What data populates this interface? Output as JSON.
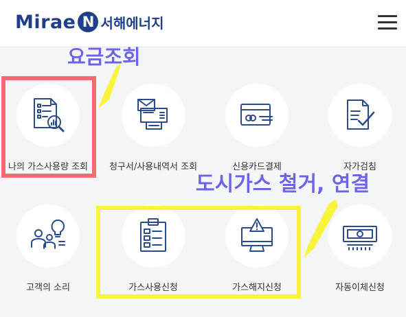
{
  "header": {
    "logo_main": "Mirae",
    "logo_letter": "N",
    "logo_korean": "서해에너지"
  },
  "services": [
    {
      "label": "나의 가스사용량 조회",
      "icon": "document-magnifier-icon"
    },
    {
      "label": "청구서/사용내역서 조회",
      "icon": "mail-printer-icon"
    },
    {
      "label": "신용카드결제",
      "icon": "credit-card-icon"
    },
    {
      "label": "자가검침",
      "icon": "document-check-icon"
    },
    {
      "label": "고객의 소리",
      "icon": "people-idea-icon"
    },
    {
      "label": "가스사용신청",
      "icon": "clipboard-icon"
    },
    {
      "label": "가스해지신청",
      "icon": "monitor-warning-icon"
    },
    {
      "label": "자동이체신청",
      "icon": "banknote-icon"
    }
  ],
  "annotations": {
    "top": "요금조회",
    "bottom": "도시가스 철거, 연결"
  },
  "colors": {
    "brand": "#1f3f8a",
    "icon_stroke": "#2b4a8c",
    "annotation_text": "#6e63e8",
    "highlight_red": "#f26b73",
    "highlight_yellow": "#f6f53b",
    "arrow_yellow": "#f6f53b"
  }
}
